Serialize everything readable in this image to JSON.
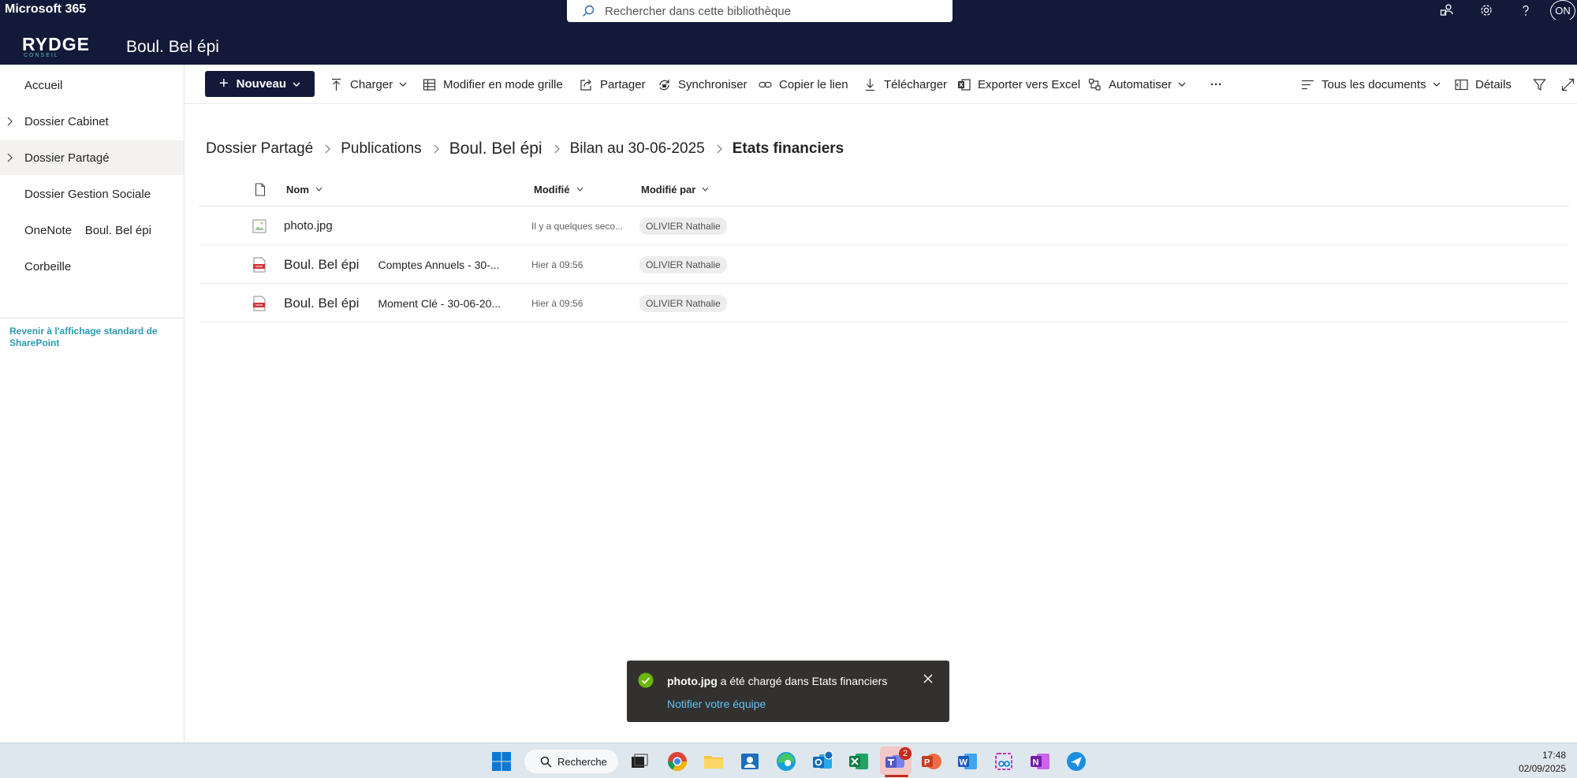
{
  "suitebar": {
    "brand": "Microsoft 365",
    "search_placeholder": "Rechercher dans cette bibliothèque",
    "avatar_initials": "ON"
  },
  "site": {
    "logo_text": "RYDGE",
    "logo_sub": "CONSEIL",
    "title": "Boul. Bel épi"
  },
  "nav": {
    "items": [
      {
        "label": "Accueil",
        "expandable": false,
        "selected": false
      },
      {
        "label": "Dossier Cabinet",
        "expandable": true,
        "selected": false
      },
      {
        "label": "Dossier Partagé",
        "expandable": true,
        "selected": true
      },
      {
        "label": "Dossier Gestion Sociale",
        "expandable": false,
        "selected": false
      },
      {
        "label": "OneNote    Boul. Bel épi",
        "expandable": false,
        "selected": false
      },
      {
        "label": "Corbeille",
        "expandable": false,
        "selected": false
      }
    ],
    "footer_link": "Revenir à l'affichage standard de SharePoint"
  },
  "commands": {
    "new": "Nouveau",
    "upload": "Charger",
    "grid_edit": "Modifier en mode grille",
    "share": "Partager",
    "sync": "Synchroniser",
    "copy_link": "Copier le lien",
    "download": "Télécharger",
    "export_excel": "Exporter vers Excel",
    "automate": "Automatiser",
    "more": "···",
    "view": "Tous les documents",
    "details": "Détails"
  },
  "breadcrumb": [
    "Dossier Partagé",
    "Publications",
    "Boul. Bel épi",
    "Bilan au 30-06-2025",
    "Etats financiers"
  ],
  "table": {
    "columns": {
      "name": "Nom",
      "modified": "Modifié",
      "modified_by": "Modifié par"
    },
    "rows": [
      {
        "type": "image",
        "name_main": "photo.jpg",
        "name_sub": "",
        "modified": "Il y a quelques seco...",
        "modified_by": "OLIVIER Nathalie"
      },
      {
        "type": "pdf",
        "name_main": "Boul. Bel épi",
        "name_sub": "Comptes Annuels - 30-...",
        "modified": "Hier à 09:56",
        "modified_by": "OLIVIER Nathalie"
      },
      {
        "type": "pdf",
        "name_main": "Boul. Bel épi",
        "name_sub": "Moment Clé - 30-06-20...",
        "modified": "Hier à 09:56",
        "modified_by": "OLIVIER Nathalie"
      }
    ]
  },
  "toast": {
    "file": "photo.jpg",
    "message": "a été chargé dans Etats financiers",
    "link": "Notifier votre équipe"
  },
  "taskbar": {
    "search": "Recherche",
    "teams_badge": "2",
    "time": "17:48",
    "date": "02/09/2025"
  },
  "colors": {
    "header_bg": "#131938",
    "accent_link": "#2a9ab3",
    "toast_bg": "#323130",
    "success": "#6bb700"
  }
}
